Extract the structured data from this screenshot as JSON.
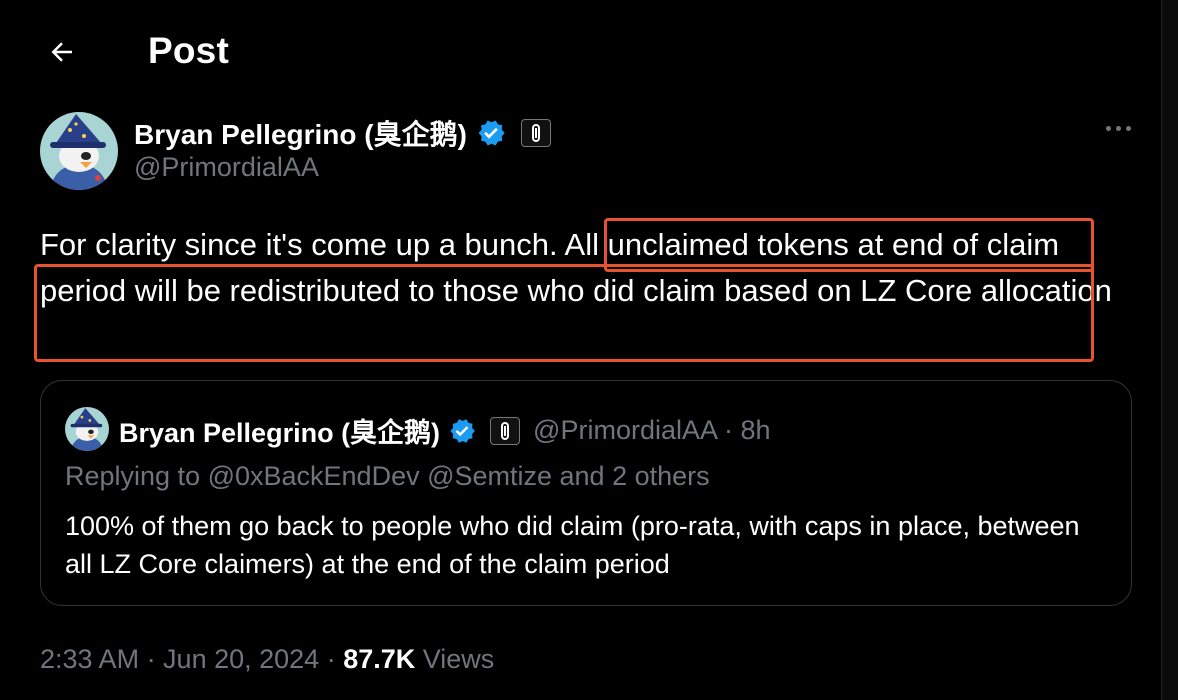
{
  "header": {
    "title": "Post",
    "back_icon": "arrow-left-icon"
  },
  "author": {
    "name": "Bryan Pellegrino (臭企鹅)",
    "handle": "@PrimordialAA",
    "verified_icon": "verified-badge-icon",
    "affiliate_icon": "layerzero-icon"
  },
  "tweet": {
    "text_before": "For clarity since it's come up a bunch. ",
    "text_highlight": "All unclaimed tokens at end of claim period will be redistributed to those who did claim based on LZ Core allocation",
    "highlight_color": "#e8532f"
  },
  "quote": {
    "name": "Bryan Pellegrino (臭企鹅)",
    "handle_time": "@PrimordialAA · 8h",
    "replying": "Replying to @0xBackEndDev @Semtize and 2 others",
    "text": "100% of them go back to people who did claim (pro-rata, with caps in place, between all LZ Core claimers) at the end of the claim period"
  },
  "meta": {
    "timestamp": "2:33 AM · Jun 20, 2024 · ",
    "views_count": "87.7K",
    "views_label": " Views"
  },
  "colors": {
    "verified": "#1d9bf0",
    "muted": "#71767b",
    "background": "#000000"
  }
}
